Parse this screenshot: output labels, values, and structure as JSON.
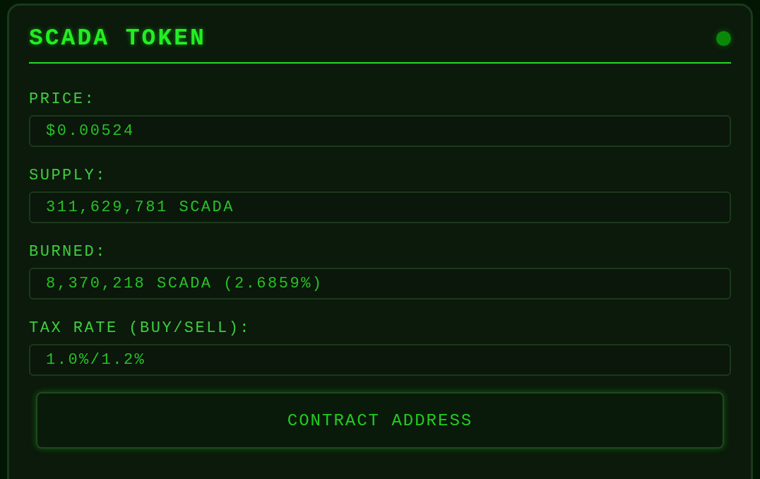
{
  "card": {
    "title": "SCADA TOKEN",
    "status_online": true,
    "fields": [
      {
        "label": "PRICE:",
        "value": "$0.00524"
      },
      {
        "label": "SUPPLY:",
        "value": "311,629,781 SCADA"
      },
      {
        "label": "BURNED:",
        "value": "8,370,218 SCADA (2.6859%)"
      },
      {
        "label": "TAX RATE (BUY/SELL):",
        "value": "1.0%/1.2%"
      }
    ],
    "button": "CONTRACT ADDRESS"
  }
}
